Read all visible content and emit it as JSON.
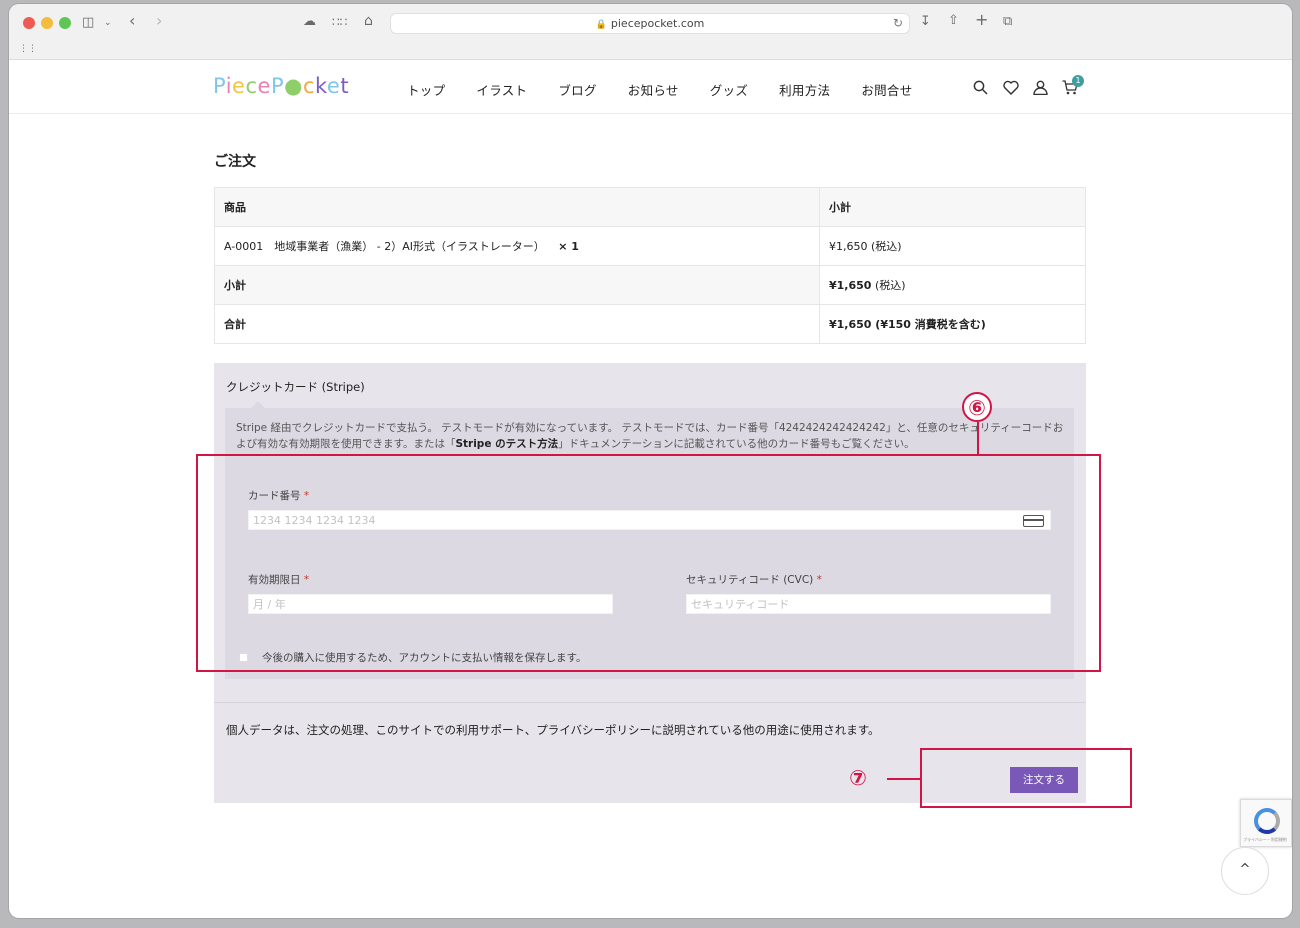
{
  "browser": {
    "url": "piecepocket.com",
    "traffic_lights": [
      "#ee5b52",
      "#f4bc3d",
      "#5fc655"
    ]
  },
  "site": {
    "logo": "PieceP●cket",
    "nav": [
      "トップ",
      "イラスト",
      "ブログ",
      "お知らせ",
      "グッズ",
      "利用方法",
      "お問合せ"
    ],
    "cart_count": "1",
    "accent_color": "#7a58b8",
    "badge_color": "#3f9f9f"
  },
  "order": {
    "title": "ご注文",
    "table": {
      "headers": [
        "商品",
        "小計"
      ],
      "item_name": "A-0001　地域事業者（漁業） - 2）AI形式（イラストレーター）",
      "item_qty": "× 1",
      "item_price": "¥1,650 (税込)",
      "subtotal_label": "小計",
      "subtotal_amount": "¥1,650",
      "subtotal_suffix": "(税込)",
      "total_label": "合計",
      "total_amount": "¥1,650",
      "total_suffix": "(¥150 消費税を含む)"
    }
  },
  "payment": {
    "method_label": "クレジットカード (Stripe)",
    "desc_part1": "Stripe 経由でクレジットカードで支払う。 テストモードが有効になっています。 テストモードでは、カード番号「4242424242424242」と、任意のセキュリティーコードおよび有効な有効期限を使用できます。または「",
    "desc_link": "Stripe のテスト方法",
    "desc_part2": "」ドキュメンテーションに記載されている他のカード番号もご覧ください。",
    "card_number_label": "カード番号",
    "card_number_placeholder": "1234 1234 1234 1234",
    "expiry_label": "有効期限日",
    "expiry_placeholder": "月 / 年",
    "cvc_label": "セキュリティコード (CVC)",
    "cvc_placeholder": "セキュリティコード",
    "required_mark": "*",
    "save_info_label": "今後の購入に使用するため、アカウントに支払い情報を保存します。",
    "privacy_text": "個人データは、注文の処理、このサイトでの利用サポート、プライバシーポリシーに説明されている他の用途に使用されます。",
    "place_order_label": "注文する"
  },
  "annotations": {
    "step6": "⑥",
    "step7": "⑦",
    "color": "#d11645"
  },
  "widgets": {
    "recaptcha_text": "プライバシー・利用規約",
    "scroll_top_icon": "^"
  }
}
